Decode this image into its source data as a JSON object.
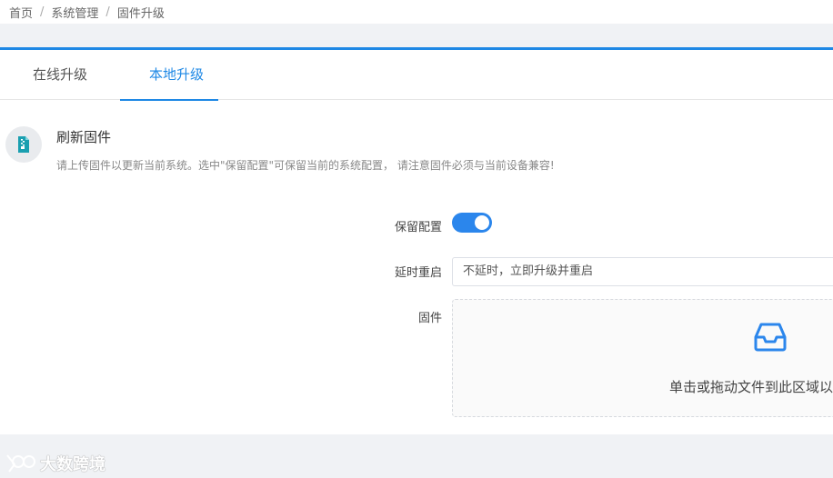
{
  "breadcrumb": [
    "首页",
    "系统管理",
    "固件升级"
  ],
  "tabs": [
    {
      "label": "在线升级",
      "active": false
    },
    {
      "label": "本地升级",
      "active": true
    }
  ],
  "info": {
    "icon": "firmware-file-icon",
    "title": "刷新固件",
    "description": "请上传固件以更新当前系统。选中\"保留配置\"可保留当前的系统配置， 请注意固件必须与当前设备兼容!"
  },
  "form": {
    "keep_config_label": "保留配置",
    "keep_config_enabled": true,
    "delay_reboot_label": "延时重启",
    "delay_reboot_value": "不延时，立即升级并重启",
    "firmware_label": "固件",
    "upload_text": "单击或拖动文件到此区域以"
  },
  "watermark": "大数跨境",
  "colors": {
    "accent": "#1e88e5",
    "switch_on": "#2b86ec"
  }
}
